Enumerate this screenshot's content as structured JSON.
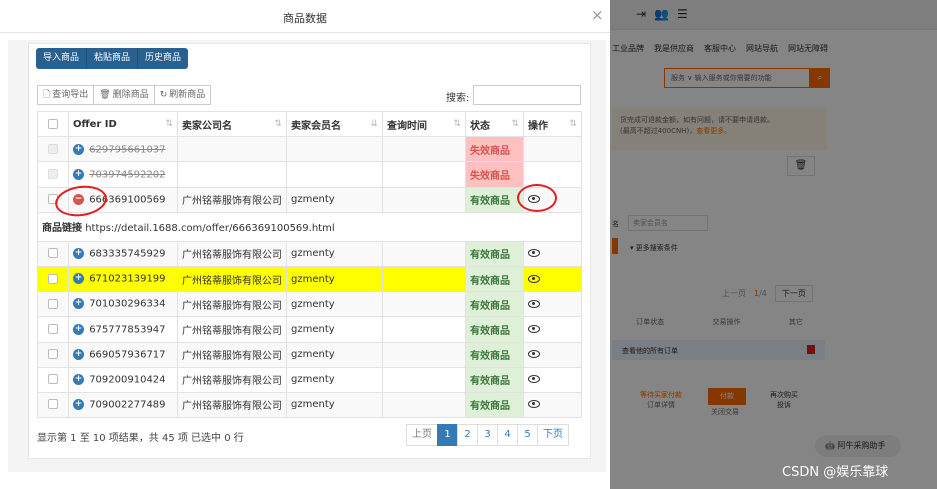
{
  "background": {
    "nav_items": [
      "工业品牌",
      "我是供应商",
      "客服中心",
      "网站导航",
      "网站无障碍"
    ],
    "search_scope": "服务",
    "search_placeholder": "输入服务或你需要的功能",
    "notice_line1": "货完成可退款金额，如有问题，请不要申请退款。",
    "notice_line2_a": "(最高不超过400CNH)，",
    "notice_line2_b": "查看更多。",
    "seller_label": "名",
    "seller_placeholder": "卖家会员名",
    "more_search": "更多搜索条件",
    "pager_prev": "上一页",
    "pager_current": "1",
    "pager_total": "/4",
    "pager_next": "下一页",
    "col_headers": [
      "订单状态",
      "交易操作",
      "其它"
    ],
    "contact_line": "查看他的所有订单",
    "action_wait": "等待买家付款",
    "action_detail": "订单详情",
    "pay_button": "付款",
    "close_deal": "关闭交易",
    "rebuy_line1": "再次购买",
    "rebuy_line2": "投诉",
    "helper_label": "阿牛采购助手",
    "watermark": "CSDN @娱乐靠球"
  },
  "modal": {
    "title": "商品数据",
    "close_glyph": "×",
    "top_buttons": [
      "导入商品",
      "粘贴商品",
      "历史商品"
    ],
    "toolbar": [
      {
        "icon": "document-icon",
        "glyph": "🗋",
        "label": "查询导出"
      },
      {
        "icon": "trash-icon",
        "glyph": "🗑",
        "label": "删除商品"
      },
      {
        "icon": "refresh-icon",
        "glyph": "↻",
        "label": "刷新商品"
      }
    ],
    "search_label": "搜索:",
    "search_value": "",
    "columns": [
      "Offer ID",
      "卖家公司名",
      "卖家会员名",
      "查询时间",
      "状态",
      "操作"
    ],
    "rows": [
      {
        "offer_id": "629795661037",
        "company": "",
        "member": "",
        "time": "",
        "status": "失效商品"
      },
      {
        "offer_id": "703974592202",
        "company": "",
        "member": "",
        "time": "",
        "status": "失效商品"
      },
      {
        "offer_id": "666369100569",
        "company": "广州铭蒂服饰有限公司",
        "member": "gzmenty",
        "time": "",
        "status": "有效商品"
      },
      {
        "offer_id": "683335745929",
        "company": "广州铭蒂服饰有限公司",
        "member": "gzmenty",
        "time": "",
        "status": "有效商品"
      },
      {
        "offer_id": "671023139199",
        "company": "广州铭蒂服饰有限公司",
        "member": "gzmenty",
        "time": "",
        "status": "有效商品"
      },
      {
        "offer_id": "701030296334",
        "company": "广州铭蒂服饰有限公司",
        "member": "gzmenty",
        "time": "",
        "status": "有效商品"
      },
      {
        "offer_id": "675777853947",
        "company": "广州铭蒂服饰有限公司",
        "member": "gzmenty",
        "time": "",
        "status": "有效商品"
      },
      {
        "offer_id": "669057936717",
        "company": "广州铭蒂服饰有限公司",
        "member": "gzmenty",
        "time": "",
        "status": "有效商品"
      },
      {
        "offer_id": "709200910424",
        "company": "广州铭蒂服饰有限公司",
        "member": "gzmenty",
        "time": "",
        "status": "有效商品"
      },
      {
        "offer_id": "709002277489",
        "company": "广州铭蒂服饰有限公司",
        "member": "gzmenty",
        "time": "",
        "status": "有效商品"
      }
    ],
    "detail_label": "商品链接",
    "detail_url": "https://detail.1688.com/offer/666369100569.html",
    "footer_info": "显示第 1 至 10 项结果，共 45 项   已选中 0 行",
    "pagination": [
      "上页",
      "1",
      "2",
      "3",
      "4",
      "5",
      "下页"
    ],
    "colors": {
      "primary": "#286090",
      "invalid_bg": "#ffc0c0",
      "valid_bg": "#dff0d8",
      "highlight": "#ffff00"
    }
  }
}
